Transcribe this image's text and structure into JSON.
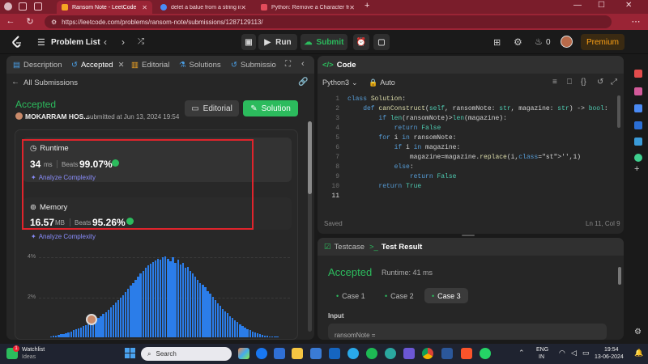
{
  "browser": {
    "tabs": [
      {
        "title": "Ransom Note - LeetCode",
        "active": true
      },
      {
        "title": "delet a balue from a string in pyt",
        "active": false
      },
      {
        "title": "Python: Remove a Character from",
        "active": false
      }
    ],
    "url": "https://leetcode.com/problems/ransom-note/submissions/1287129113/"
  },
  "header": {
    "problem_list": "Problem List",
    "run": "Run",
    "submit": "Submit",
    "streak": "0",
    "premium": "Premium"
  },
  "left": {
    "tabs": [
      "Description",
      "Accepted",
      "Editorial",
      "Solutions",
      "Submissio"
    ],
    "back": "All Submissions",
    "status": "Accepted",
    "author": "MOKARRAM HOS...",
    "submitted": "submitted at Jun 13, 2024 19:54",
    "editorial_btn": "Editorial",
    "solution_btn": "Solution",
    "runtime_title": "Runtime",
    "runtime_value": "34",
    "runtime_unit": "ms",
    "beats_label": "Beats",
    "runtime_beats": "99.07%",
    "analyze": "Analyze Complexity",
    "memory_title": "Memory",
    "memory_value": "16.57",
    "memory_unit": "MB",
    "memory_beats": "95.26%",
    "y_labels": [
      "4%",
      "2%"
    ]
  },
  "code": {
    "title": "Code",
    "language": "Python3",
    "mode": "Auto",
    "lines": [
      "class Solution:",
      "    def canConstruct(self, ransomNote: str, magazine: str) -> bool:",
      "        if len(ransomNote)>len(magazine):",
      "            return False",
      "        for i in ransomNote:",
      "            if i in magazine:",
      "                magazine=magazine.replace(i,'',1)",
      "            else:",
      "                return False",
      "        return True",
      ""
    ],
    "saved": "Saved",
    "position": "Ln 11, Col 9"
  },
  "result": {
    "testcase_tab": "Testcase",
    "result_tab": "Test Result",
    "status": "Accepted",
    "runtime": "Runtime: 41 ms",
    "cases": [
      "Case 1",
      "Case 2",
      "Case 3"
    ],
    "input_label": "Input",
    "input_name": "ransomNote ="
  },
  "taskbar": {
    "watchlist": "Watchlist",
    "ideas": "Ideas",
    "search": "Search",
    "lang": "ENG",
    "region": "IN",
    "time": "19:54",
    "date": "13-06-2024",
    "badge": "1"
  },
  "chart_data": {
    "type": "bar",
    "title": "",
    "ylabel": "",
    "ylim": [
      0,
      4.6
    ],
    "values": [
      0.05,
      0.08,
      0.1,
      0.12,
      0.15,
      0.18,
      0.22,
      0.26,
      0.3,
      0.35,
      0.4,
      0.45,
      0.5,
      0.55,
      0.6,
      0.66,
      0.72,
      0.8,
      0.88,
      0.96,
      1.05,
      1.15,
      1.25,
      1.36,
      1.48,
      1.6,
      1.72,
      1.85,
      1.98,
      2.1,
      2.25,
      2.4,
      2.55,
      2.7,
      2.85,
      3.0,
      3.15,
      3.3,
      3.45,
      3.55,
      3.65,
      3.72,
      3.8,
      3.9,
      3.85,
      3.95,
      4.0,
      3.9,
      3.75,
      3.95,
      3.7,
      3.85,
      3.6,
      3.7,
      3.45,
      3.5,
      3.3,
      3.15,
      3.0,
      2.85,
      2.7,
      2.6,
      2.5,
      2.3,
      2.15,
      2.0,
      1.85,
      1.7,
      1.55,
      1.4,
      1.3,
      1.2,
      1.05,
      0.95,
      0.85,
      0.75,
      0.65,
      0.58,
      0.5,
      0.42,
      0.36,
      0.3,
      0.25,
      0.2,
      0.16,
      0.12,
      0.1,
      0.08,
      0.06,
      0.05,
      0.04,
      0.03,
      0.02
    ],
    "colors": {
      "bar": "#2b7de9"
    }
  }
}
